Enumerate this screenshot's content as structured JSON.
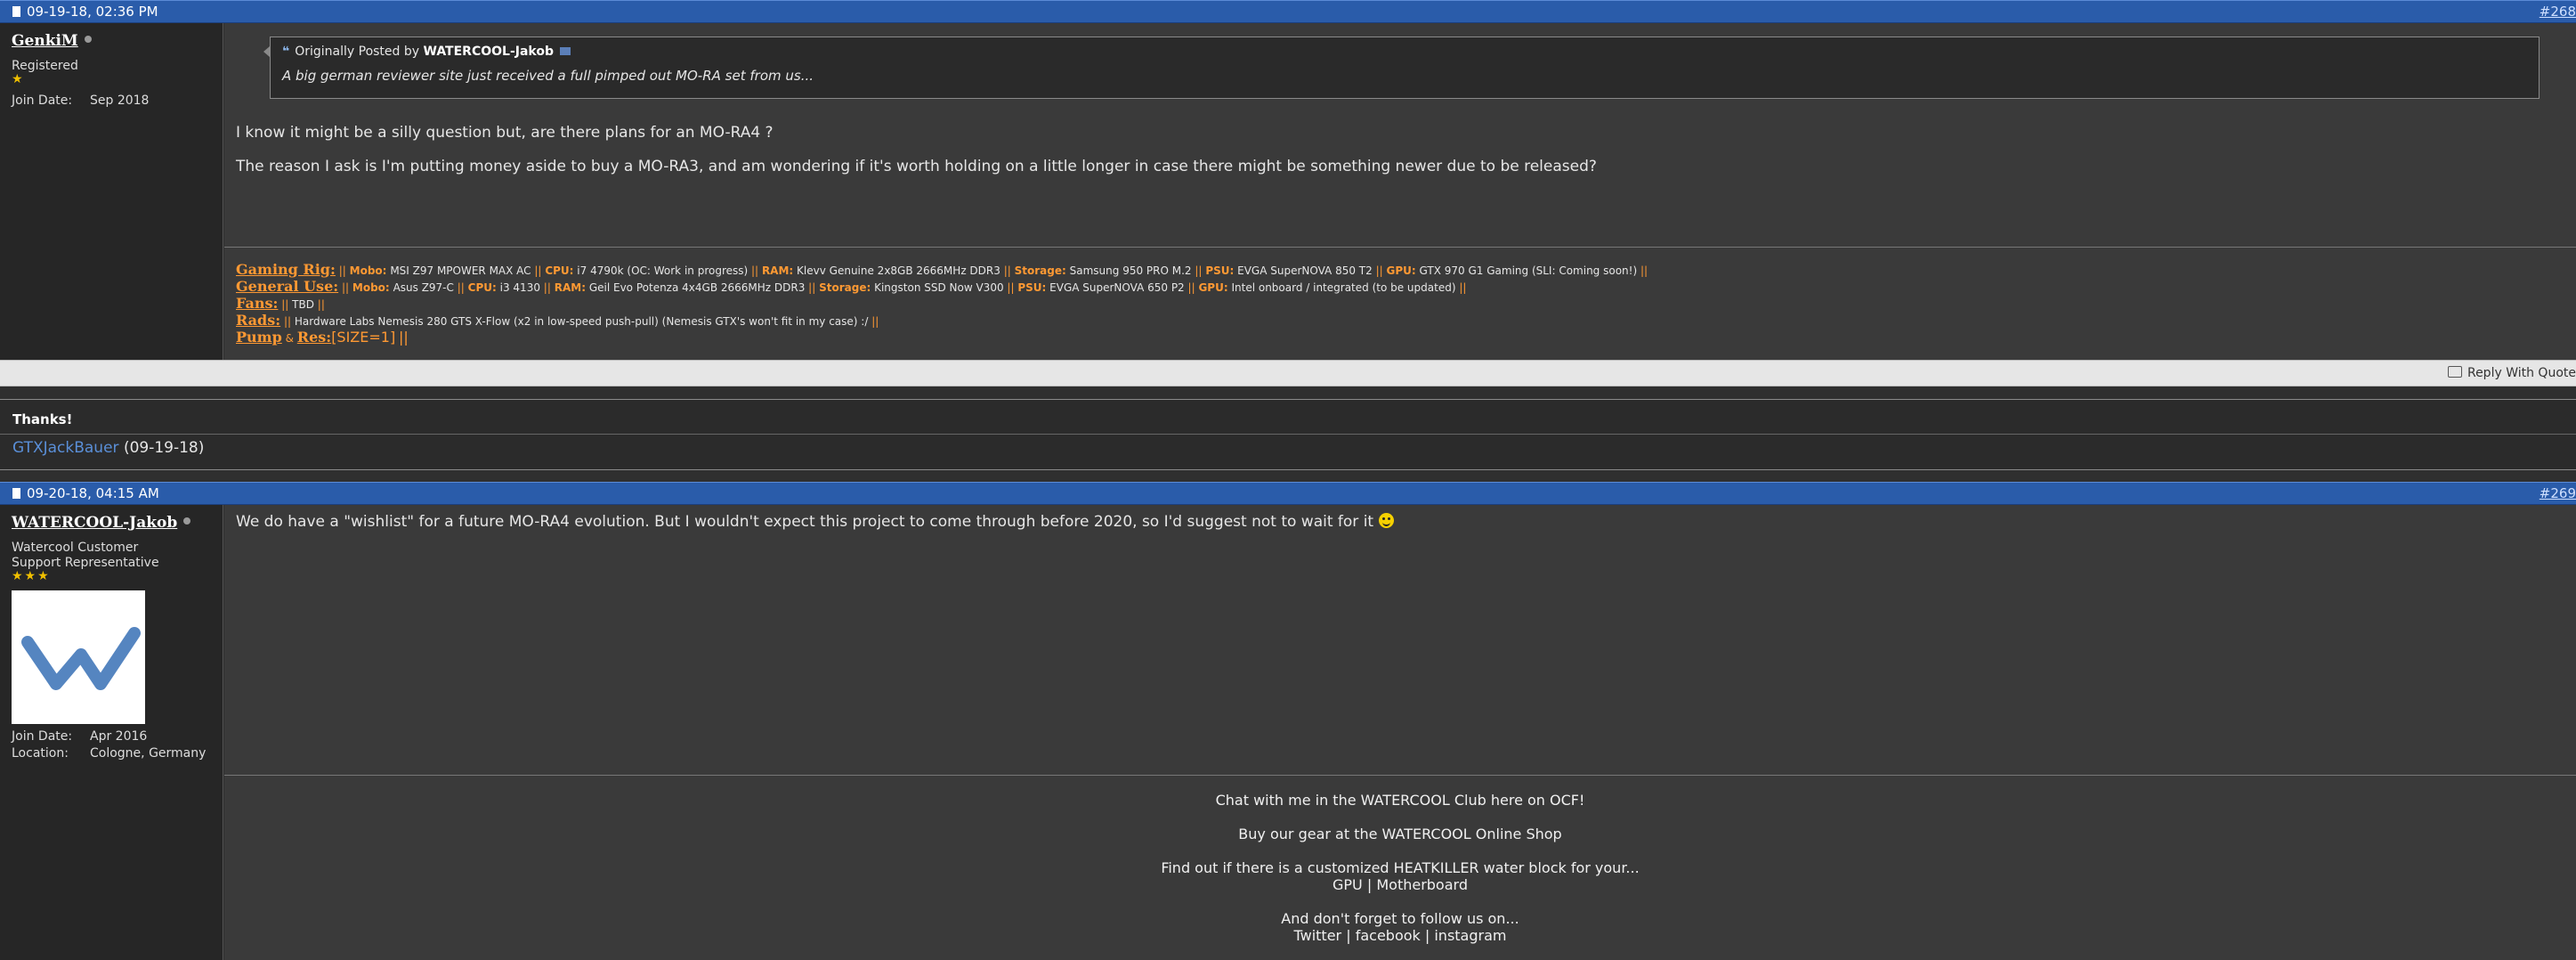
{
  "post1": {
    "date": "09-19-18, 02:36 PM",
    "number": "#268",
    "username": "GenkiM",
    "title": "Registered",
    "join_label": "Join Date:",
    "join_date": "Sep 2018",
    "quote_prefix": "Originally Posted by",
    "quote_author": "WATERCOOL-Jakob",
    "quote_text": "A big german reviewer site just received a full pimped out MO-RA set from us...",
    "text1": "I know it might be a silly question but, are there plans for an MO-RA4 ?",
    "text2": "The reason I ask is I'm putting money aside to buy a MO-RA3, and am wondering if it's worth holding on a little longer in case there might be something newer due to be released?",
    "sig": {
      "gaming_head": "Gaming Rig:",
      "mobo_label": "Mobo:",
      "mobo": "MSI Z97 MPOWER MAX AC",
      "cpu_label": "CPU:",
      "cpu": "i7 4790k (OC: Work in progress)",
      "ram_label": "RAM:",
      "ram": "Klevv Genuine 2x8GB 2666MHz DDR3",
      "storage_label": "Storage:",
      "storage": "Samsung 950 PRO M.2",
      "psu_label": "PSU:",
      "psu": "EVGA SuperNOVA 850 T2",
      "gpu_label": "GPU:",
      "gpu": "GTX 970 G1 Gaming (SLI: Coming soon!)",
      "general_head": "General Use:",
      "g_mobo": "Asus Z97-C",
      "g_cpu": "i3 4130",
      "g_ram": "Geil Evo Potenza 4x4GB 2666MHz DDR3",
      "g_storage": "Kingston SSD Now V300",
      "g_psu": "EVGA SuperNOVA 650 P2",
      "g_gpu": "Intel onboard / integrated (to be updated)",
      "fans_head": "Fans:",
      "fans": "TBD",
      "rads_head": "Rads:",
      "rads": "Hardware Labs Nemesis 280 GTS X-Flow (x2 in low-speed push-pull) (Nemesis GTX's won't fit in my case) :/",
      "pump_head": "Pump",
      "amp": "&",
      "res_head": "Res:",
      "pump": "[SIZE=1]",
      "sep": "||"
    },
    "reply_quote": "Reply With Quote",
    "thanks_label": "Thanks!",
    "thanks_user": "GTXJackBauer",
    "thanks_date": "(09-19-18)"
  },
  "post2": {
    "date": "09-20-18, 04:15 AM",
    "number": "#269",
    "username": "WATERCOOL-Jakob",
    "title_line1": "Watercool Customer",
    "title_line2": "Support Representative",
    "join_label": "Join Date:",
    "join_date": "Apr 2016",
    "location_label": "Location:",
    "location": "Cologne, Germany",
    "text": "We do have a \"wishlist\" for a future MO-RA4 evolution. But I wouldn't expect this project to come through before 2020, so I'd suggest not to wait for it",
    "sig": {
      "chat_prefix": "Chat with me in the",
      "chat_link": "WATERCOOL Club here on OCF!",
      "buy_prefix": "Buy our gear at the",
      "buy_link": "WATERCOOL Online Shop",
      "find": "Find out if there is a customized HEATKILLER water block for your...",
      "gpu": "GPU",
      "pipe": "|",
      "motherboard": "Motherboard",
      "follow": "And don't forget to follow us on...",
      "twitter": "Twitter",
      "facebook": "facebook",
      "instagram": "instagram"
    }
  }
}
